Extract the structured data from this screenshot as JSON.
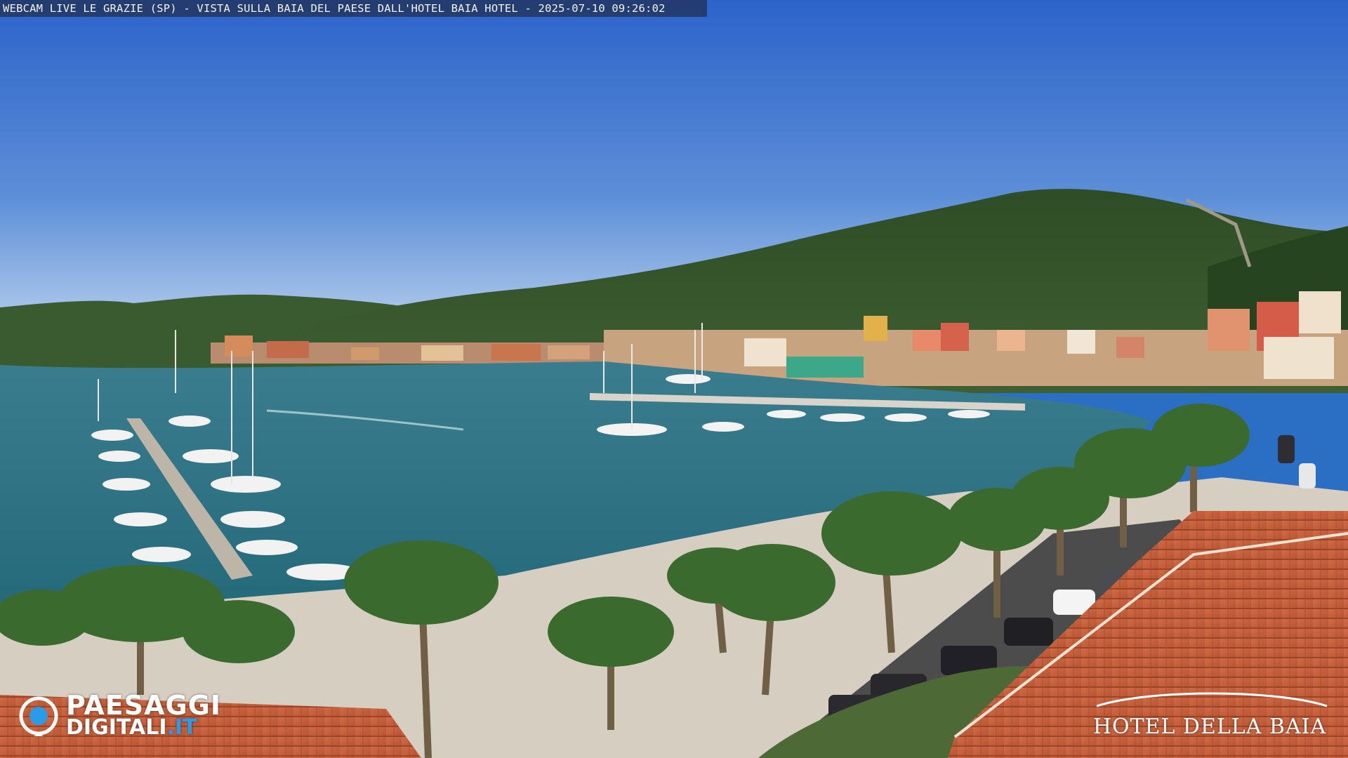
{
  "overlay": {
    "caption": "WEBCAM LIVE LE GRAZIE (SP) - VISTA SULLA BAIA DEL PAESE DALL'HOTEL BAIA HOTEL - 2025-07-10 09:26:02"
  },
  "watermark_left": {
    "line1": "PAESAGGI",
    "line2_name": "DIGITALI",
    "line2_tld": ".IT",
    "icon": "camera-lens-icon",
    "color_accent": "#2a9be8"
  },
  "watermark_right": {
    "text": "HOTEL DELLA BAIA"
  },
  "scene": {
    "description_colors": {
      "sky_top": "#2f6fd0",
      "sky_bottom": "#a9c8ec",
      "sea": "#2c6e80",
      "hill": "#2c4a22",
      "roof": "#c9603d",
      "promenade": "#d8d2c6"
    }
  }
}
